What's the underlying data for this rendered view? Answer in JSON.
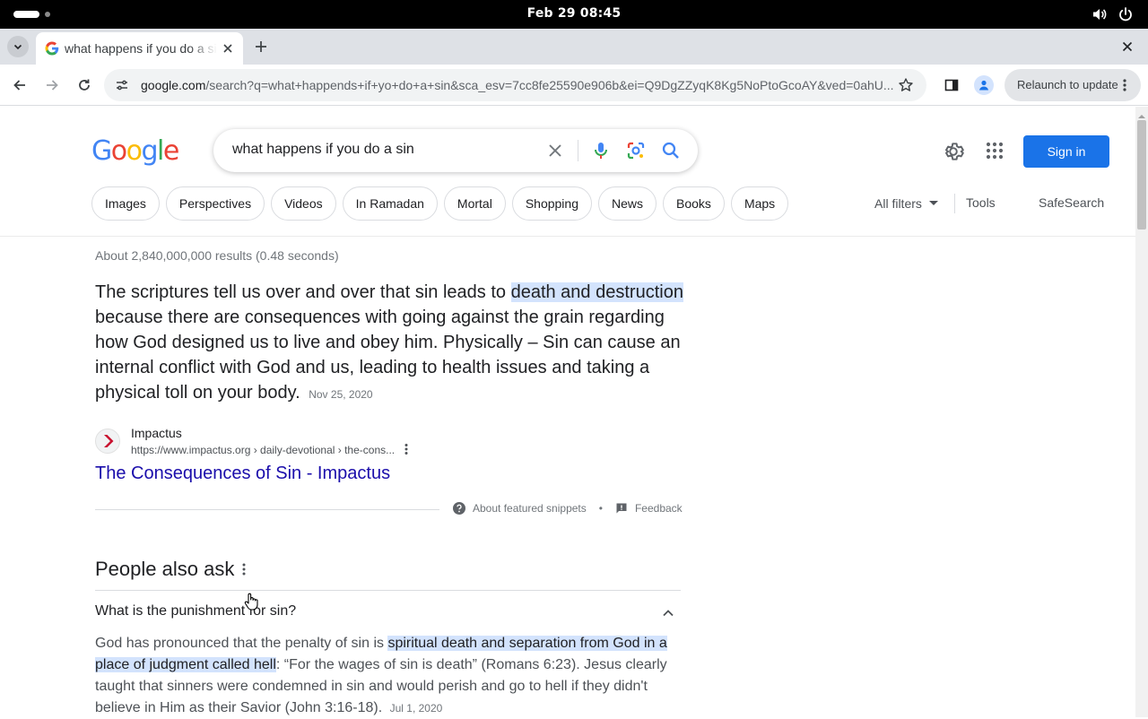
{
  "system": {
    "clock": "Feb 29  08:45"
  },
  "browser": {
    "tab_title": "what happens if you do a sin",
    "url_host": "google.com",
    "url_rest": "/search?q=what+happends+if+yo+do+a+sin&sca_esv=7cc8fe25590e906b&ei=Q9DgZZyqK8Kg5NoPtoGcoAY&ved=0ahU...",
    "relaunch_label": "Relaunch to update"
  },
  "google": {
    "search_query": "what happens if you do a sin",
    "signin_label": "Sign in",
    "chips": [
      "Images",
      "Perspectives",
      "Videos",
      "In Ramadan",
      "Mortal",
      "Shopping",
      "News",
      "Books",
      "Maps"
    ],
    "all_filters": "All filters",
    "tools": "Tools",
    "safesearch": "SafeSearch"
  },
  "results": {
    "stats": "About 2,840,000,000 results (0.48 seconds)",
    "featured": {
      "text_before": "The scriptures tell us over and over that sin leads to ",
      "highlight": "death and destruction",
      "text_after": " because there are consequences with going against the grain regarding how God designed us to live and obey him. Physically – Sin can cause an internal conflict with God and us, leading to health issues and taking a physical toll on your body.",
      "date": "Nov 25, 2020",
      "source_name": "Impactus",
      "source_url": "https://www.impactus.org › daily-devotional › the-cons...",
      "title": "The Consequences of Sin - Impactus",
      "about_label": "About featured snippets",
      "dot": "•",
      "feedback_label": "Feedback"
    },
    "paa": {
      "title": "People also ask",
      "question": "What is the punishment for sin?",
      "answer_before": "God has pronounced that the penalty of sin is ",
      "answer_highlight": "spiritual death and separation from God in a place of judgment called hell",
      "answer_after": ": “For the wages of sin is death” (Romans 6:23). Jesus clearly taught that sinners were condemned in sin and would perish and go to hell if they didn't believe in Him as their Savior (John 3:16-18).",
      "answer_date": "Jul 1, 2020"
    }
  },
  "colors": {
    "link": "#1a0dab",
    "highlight": "#d3e3fd",
    "signin": "#1a73e8"
  },
  "icons": [
    "volume-icon",
    "power-icon",
    "google-favicon",
    "close-icon",
    "plus-icon",
    "back-icon",
    "forward-icon",
    "reload-icon",
    "tune-icon",
    "star-icon",
    "side-panel-icon",
    "profile-icon",
    "more-vert-icon",
    "clear-icon",
    "mic-icon",
    "lens-icon",
    "search-icon",
    "gear-icon",
    "apps-grid-icon",
    "caret-down-icon",
    "help-icon",
    "feedback-icon",
    "chevron-up-icon",
    "cursor-icon"
  ]
}
